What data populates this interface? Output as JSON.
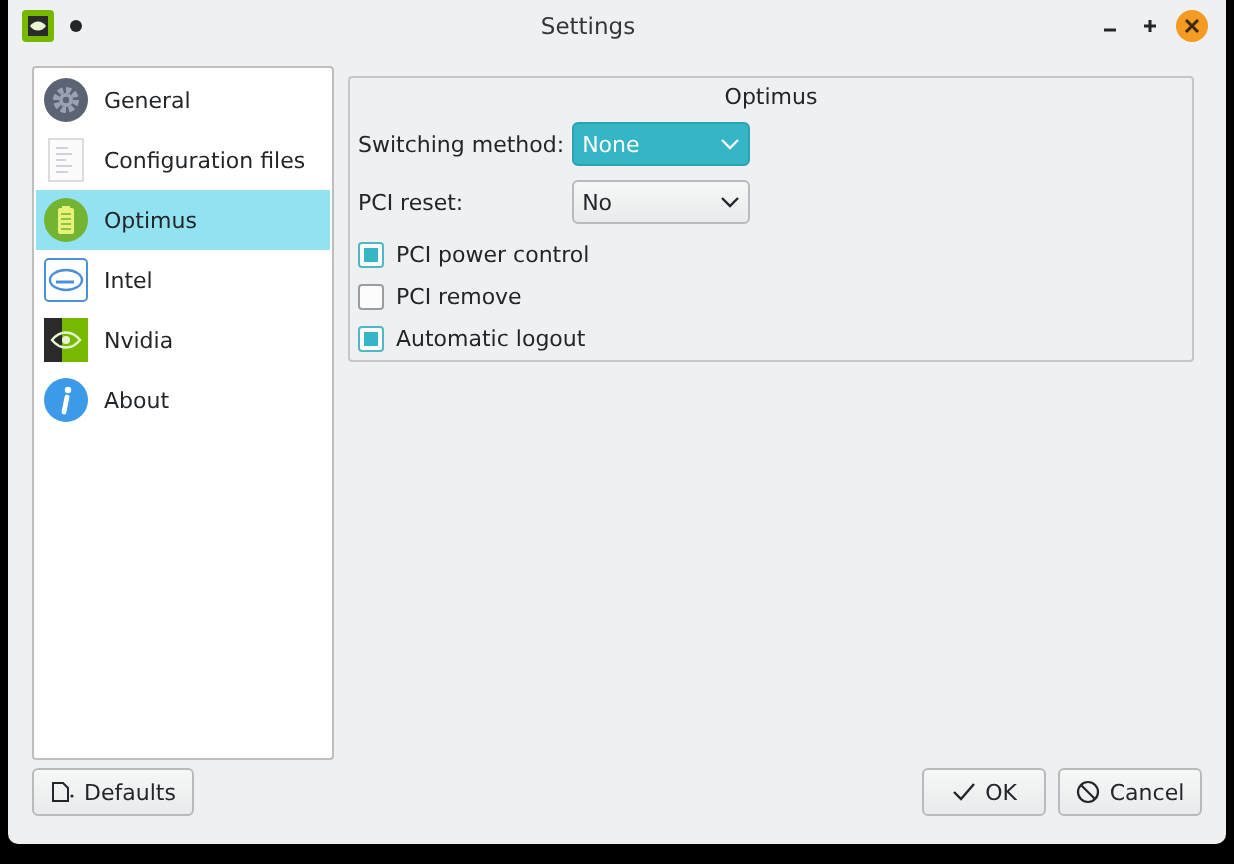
{
  "window": {
    "title": "Settings"
  },
  "sidebar": {
    "items": [
      {
        "kind": "gear",
        "label": "General",
        "selected": false
      },
      {
        "kind": "document",
        "label": "Configuration files",
        "selected": false
      },
      {
        "kind": "battery",
        "label": "Optimus",
        "selected": true
      },
      {
        "kind": "intel",
        "label": "Intel",
        "selected": false
      },
      {
        "kind": "nvidia",
        "label": "Nvidia",
        "selected": false
      },
      {
        "kind": "info",
        "label": "About",
        "selected": false
      }
    ]
  },
  "group": {
    "title": "Optimus",
    "combos": [
      {
        "label": "Switching method:",
        "value": "None",
        "focused": true
      },
      {
        "label": "PCI reset:",
        "value": "No",
        "focused": false
      }
    ],
    "checkboxes": [
      {
        "label": "PCI power control",
        "checked": true
      },
      {
        "label": "PCI remove",
        "checked": false
      },
      {
        "label": "Automatic logout",
        "checked": true
      }
    ]
  },
  "buttons": {
    "defaults": "Defaults",
    "ok": "OK",
    "cancel": "Cancel"
  }
}
